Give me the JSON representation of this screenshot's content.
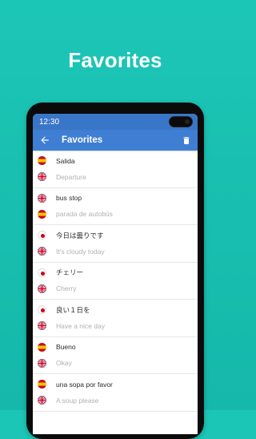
{
  "headline": "Favorites",
  "status": {
    "time": "12:30"
  },
  "appbar": {
    "title": "Favorites"
  },
  "items": [
    {
      "src_lang": "es",
      "src": "Salida",
      "dst_lang": "uk",
      "dst": "Departure"
    },
    {
      "src_lang": "uk",
      "src": "bus stop",
      "dst_lang": "es",
      "dst": "parada de autobús"
    },
    {
      "src_lang": "jp",
      "src": "今日は曇りです",
      "dst_lang": "uk",
      "dst": "It's cloudy today"
    },
    {
      "src_lang": "jp",
      "src": "チェリー",
      "dst_lang": "uk",
      "dst": "Cherry"
    },
    {
      "src_lang": "jp",
      "src": "良い１日を",
      "dst_lang": "uk",
      "dst": "Have a nice day"
    },
    {
      "src_lang": "es",
      "src": "Bueno",
      "dst_lang": "uk",
      "dst": "Okay"
    },
    {
      "src_lang": "es",
      "src": "una sopa por favor",
      "dst_lang": "uk",
      "dst": "A soup please"
    }
  ],
  "icons": {
    "back": "arrow-left-icon",
    "delete": "trash-icon"
  },
  "colors": {
    "background": "#17bfb0",
    "appbar": "#3f7fd3",
    "statusbar": "#3a76c8"
  }
}
